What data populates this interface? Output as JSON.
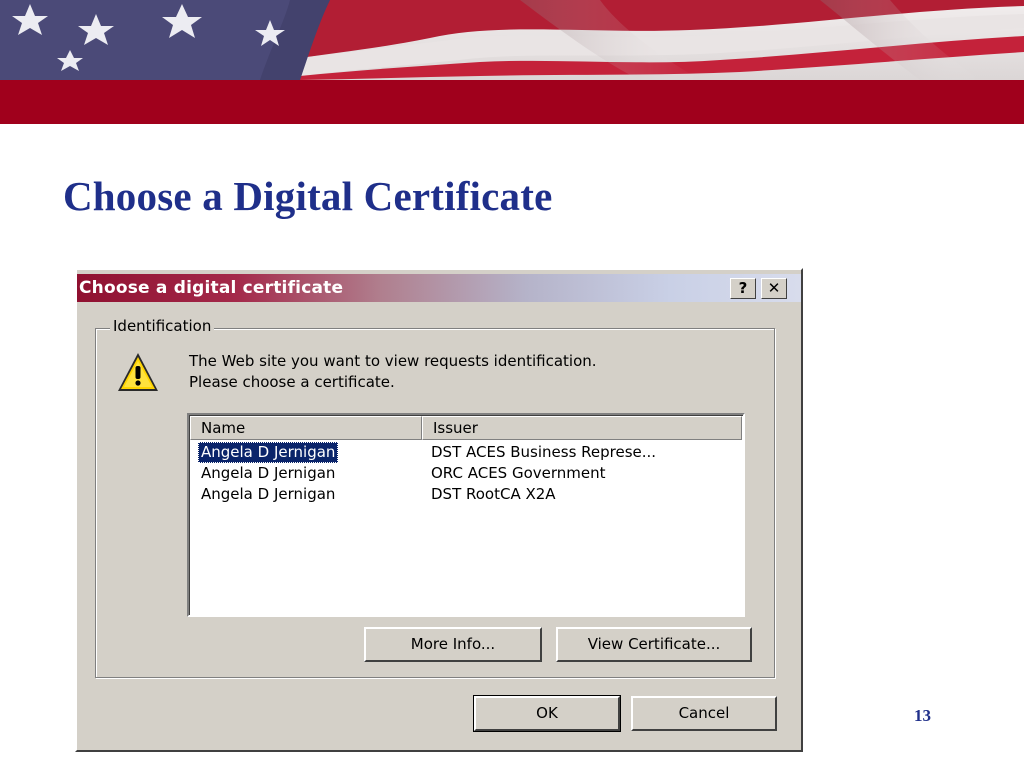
{
  "slide": {
    "title": "Choose a Digital Certificate",
    "page_number": "13"
  },
  "colors": {
    "title_blue": "#1f2f8a",
    "banner_red": "#a0001c",
    "flag_blue": "#4b4a78",
    "dialog_gray": "#d4d0c8",
    "selection_blue": "#0a246a"
  },
  "dialog": {
    "title": "Choose a digital certificate",
    "help_button": "?",
    "close_button": "✕",
    "group_label": "Identification",
    "icon": "warning-icon",
    "prompt": "The Web site you want to view requests identification. Please choose a certificate.",
    "list": {
      "columns": [
        "Name",
        "Issuer"
      ],
      "rows": [
        {
          "name": "Angela D Jernigan",
          "issuer": "DST ACES Business Represe...",
          "selected": true
        },
        {
          "name": "Angela D Jernigan",
          "issuer": "ORC ACES Government",
          "selected": false
        },
        {
          "name": "Angela D Jernigan",
          "issuer": "DST RootCA X2A",
          "selected": false
        }
      ]
    },
    "more_info_button": "More Info...",
    "view_certificate_button": "View Certificate...",
    "ok_button": "OK",
    "cancel_button": "Cancel"
  }
}
